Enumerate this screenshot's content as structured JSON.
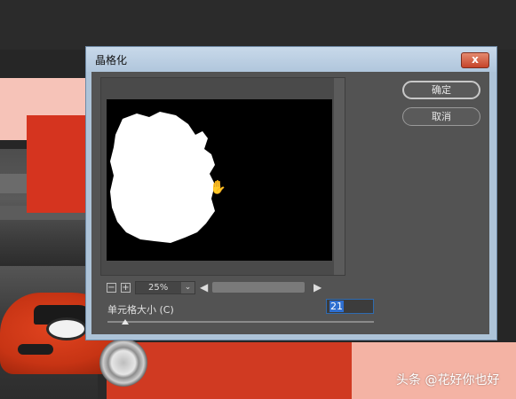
{
  "dialog": {
    "title": "晶格化",
    "close_label": "x",
    "ok_label": "确定",
    "cancel_label": "取消",
    "zoom": {
      "minus_label": "−",
      "plus_label": "+",
      "value": "25%",
      "arrow": "⌄"
    },
    "scroll": {
      "left_label": "◀",
      "right_label": "▶"
    },
    "parameter": {
      "label": "单元格大小 (C)",
      "value": "21"
    }
  },
  "watermark": "头条 @花好你也好",
  "icons": [
    "close-icon",
    "zoom-out-icon",
    "zoom-in-icon",
    "hand-cursor-icon",
    "scroll-left-icon",
    "scroll-right-icon"
  ],
  "colors": {
    "dialog_bg": "#535353",
    "preview_bg": "#000000",
    "accent": "#2f6fd0"
  }
}
